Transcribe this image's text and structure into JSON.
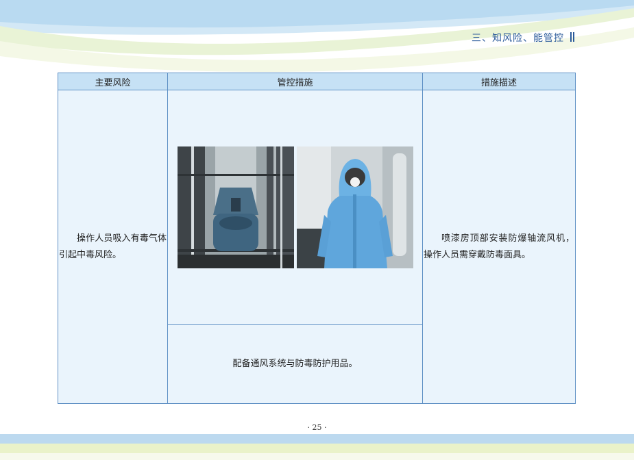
{
  "header": {
    "section_title": "三、知风险、能管控"
  },
  "table": {
    "columns": [
      "主要风险",
      "管控措施",
      "措施描述"
    ],
    "risk": "操作人员吸入有毒气体引起中毒风险。",
    "measure": "配备通风系统与防毒防护用品。",
    "description": "喷漆房顶部安装防爆轴流风机，操作人员需穿戴防毒面具。"
  },
  "footer": {
    "page_number": "· 25 ·"
  },
  "colors": {
    "header_blue": "#2a5a9a",
    "table_border": "#5d8fc4",
    "header_cell_bg": "#c6e1f5",
    "body_cell_bg": "#eaf4fc"
  }
}
